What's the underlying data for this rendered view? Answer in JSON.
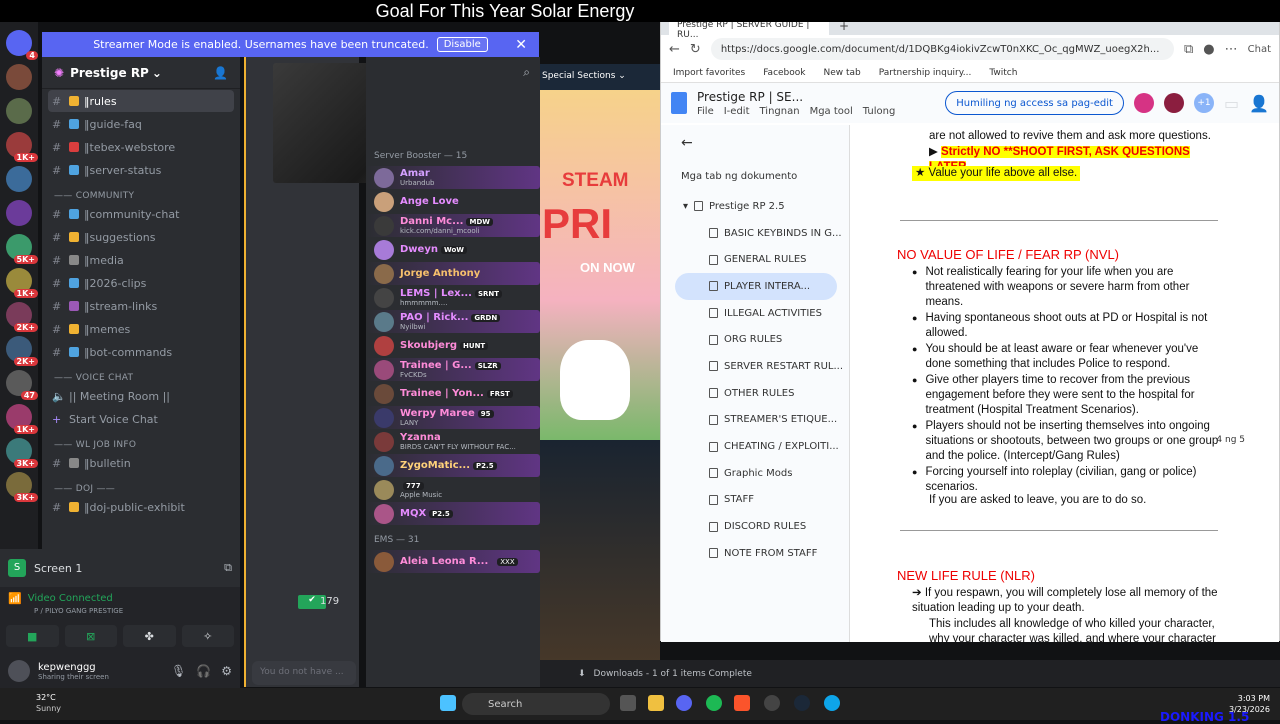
{
  "stream_title": "Goal For This Year Solar Energy",
  "discord": {
    "streamer_banner": "Streamer Mode is enabled. Usernames have been truncated.",
    "disable_label": "Disable",
    "guild_name": "Prestige RP",
    "window_title": "Prestige RP",
    "server_badges": [
      "4",
      "",
      "",
      "1K+",
      "",
      "",
      "5K+",
      "1K+",
      "2K+",
      "2K+",
      "47",
      "1K+",
      "3K+",
      "3K+"
    ],
    "channels_top": [
      {
        "name": "rules",
        "active": true,
        "color": "#f0b232"
      },
      {
        "name": "guide-faq",
        "color": "#4fa3e0"
      },
      {
        "name": "tebex-webstore",
        "color": "#d93e3e"
      },
      {
        "name": "server-status",
        "color": "#4fa3e0"
      }
    ],
    "category_community": "—— COMMUNITY",
    "channels_community": [
      {
        "name": "community-chat",
        "color": "#4fa3e0"
      },
      {
        "name": "suggestions",
        "color": "#f0b232"
      },
      {
        "name": "media",
        "color": "#888"
      },
      {
        "name": "2026-clips",
        "color": "#4fa3e0"
      },
      {
        "name": "stream-links",
        "color": "#9b59b6"
      },
      {
        "name": "memes",
        "color": "#f0b232"
      },
      {
        "name": "bot-commands",
        "color": "#4fa3e0"
      }
    ],
    "category_voice": "—— VOICE CHAT",
    "voice_channels": [
      "|| Meeting Room ||",
      "Start Voice Chat"
    ],
    "category_job": "—— WL JOB INFO",
    "channels_job": [
      {
        "name": "bulletin",
        "color": "#888"
      }
    ],
    "category_doj": "—— DOJ ——",
    "channels_doj": [
      {
        "name": "doj-public-exhibit",
        "color": "#f0b232"
      }
    ],
    "screen_label": "Screen 1",
    "video_status": "Video Connected",
    "video_channel": "P / PILYO GANG PRESTIGE",
    "user_name": "kepwenggg",
    "user_status": "Sharing their screen",
    "message_placeholder": "You do not have ...",
    "reaction_count": "179",
    "member_section_boost": "Server Booster — 15",
    "members": [
      {
        "name": "Amar",
        "status": "Urbandub",
        "tag": "",
        "color": "#d4a0ff"
      },
      {
        "name": "Ange Love",
        "status": "",
        "tag": "",
        "color": "#e58cff"
      },
      {
        "name": "Danni Mc...",
        "status": "kick.com/danni_mcooli",
        "tag": "MDW",
        "color": "#ff8cd9"
      },
      {
        "name": "Dweyn",
        "status": "",
        "tag": "WoW",
        "color": "#e58cff"
      },
      {
        "name": "Jorge Anthony",
        "status": "",
        "tag": "",
        "color": "#f6c06c"
      },
      {
        "name": "LEMS | Lex...",
        "status": "hmmmmm....",
        "tag": "SRNT",
        "color": "#e58cff"
      },
      {
        "name": "PAO | Rick...",
        "status": "Nyilbwi",
        "tag": "GRDN",
        "color": "#e58cff"
      },
      {
        "name": "Skoubjerg",
        "status": "",
        "tag": "HUNT",
        "color": "#ff8cd9"
      },
      {
        "name": "Trainee | G...",
        "status": "FvCKDs",
        "tag": "SLZR",
        "color": "#ff8cd9"
      },
      {
        "name": "Trainee | Yon...",
        "status": "",
        "tag": "FRST",
        "color": "#ff8cd9"
      },
      {
        "name": "Werpy Maree",
        "status": "LANY",
        "tag": "95",
        "color": "#ff8cd9"
      },
      {
        "name": "Yzanna",
        "status": "BIRDS CAN'T FLY WITHOUT FAC...",
        "tag": "",
        "color": "#ff8cd9"
      },
      {
        "name": "ZygoMatic...",
        "status": "",
        "tag": "P2.5",
        "color": "#ffd27a"
      },
      {
        "name": "",
        "status": "Apple Music",
        "tag": "777",
        "color": "#e58cff"
      },
      {
        "name": "MQX",
        "status": "",
        "tag": "P2.5",
        "color": "#e58cff"
      }
    ],
    "member_section_ems": "EMS — 31",
    "ems_first": {
      "name": "Aleia Leona R...",
      "tag": "XXX"
    }
  },
  "game": {
    "section_label": "Special Sections",
    "steam": "STEAM",
    "pri": "PRI",
    "on_now": "ON NOW"
  },
  "downloads": "Downloads - 1 of 1 items Complete",
  "chrome": {
    "tab_title": "Prestige RP | SERVER GUIDE | RU...",
    "url": "https://docs.google.com/document/d/1DQBKg4iokivZcwT0nXKC_Oc_qgMWZ_uoegX2h...",
    "bookmarks": [
      "Import favorites",
      "Facebook",
      "New tab",
      "Partnership inquiry...",
      "Twitch"
    ],
    "chat_label": "Chat"
  },
  "doc": {
    "title": "Prestige RP | SE...",
    "menu": [
      "File",
      "I-edit",
      "Tingnan",
      "Mga tool",
      "Tulong"
    ],
    "access_btn": "Humiling ng access sa pag-edit",
    "extra_users": "+1",
    "outline_header": "Mga tab ng dokumento",
    "outline_doc": "Prestige RP 2.5",
    "outline_items": [
      "BASIC KEYBINDS IN G...",
      "GENERAL RULES",
      "PLAYER INTERA...",
      "ILLEGAL ACTIVITIES",
      "ORG RULES",
      "SERVER RESTART RUL...",
      "OTHER RULES",
      "STREAMER'S ETIQUE...",
      "CHEATING / EXPLOITI...",
      "Graphic Mods",
      "STAFF",
      "DISCORD RULES",
      "NOTE FROM STAFF"
    ],
    "line_top": "are not allowed to revive them and ask more questions.",
    "strictly": "Strictly NO **SHOOT FIRST, ASK QUESTIONS LATER",
    "value_life": "Value your life above all else.",
    "nvl_heading": "NO VALUE OF LIFE / FEAR RP (NVL)",
    "nvl_items": [
      "Not realistically fearing for your life when you are threatened with weapons or severe harm from other means.",
      "Having spontaneous shoot outs at PD or Hospital is not allowed.",
      "You should be at least aware or fear whenever you've done something that includes Police to respond.",
      "Give other players time to recover from the previous engagement before they were sent to the hospital for treatment (Hospital Treatment Scenarios).",
      "Players should not be inserting themselves into ongoing situations or shootouts, between two groups or one group and the police. (Intercept/Gang Rules)",
      "Forcing  yourself into roleplay (civilian, gang or police) scenarios."
    ],
    "leave_line": "If you are asked to leave, you are to do so.",
    "nlr_heading": "NEW LIFE RULE (NLR)",
    "nlr_1": "If you respawn, you will completely lose all memory of the situation leading up to your death.",
    "nlr_2": "This includes all knowledge of who killed your character, why your character was killed, and where your character",
    "page_num": "4 ng 5"
  },
  "taskbar": {
    "temp": "32°C",
    "weather": "Sunny",
    "search": "Search",
    "time": "3:03 PM",
    "date": "3/23/2026"
  },
  "overlay": "DONKING 1.5"
}
